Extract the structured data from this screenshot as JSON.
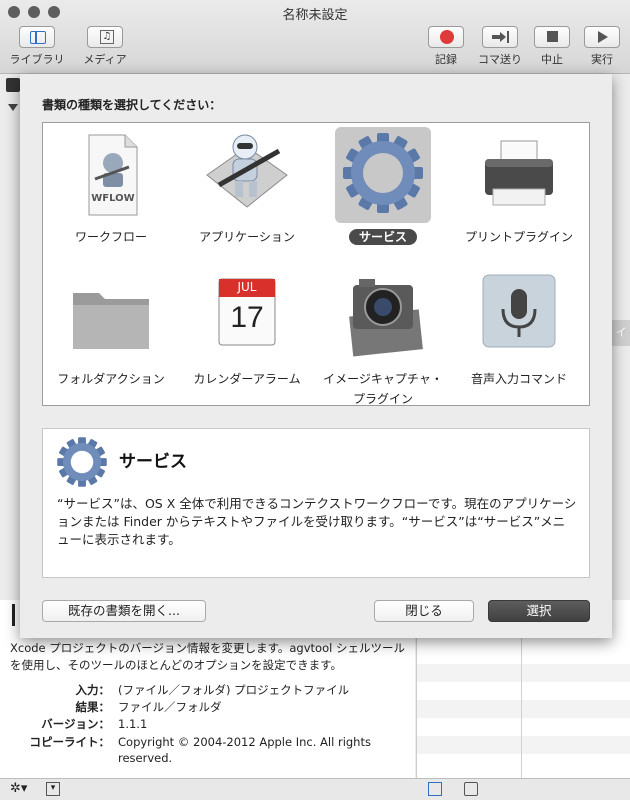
{
  "window": {
    "title": "名称未設定",
    "toolbar_left": [
      "ライブラリ",
      "メディア"
    ],
    "toolbar_right": [
      "記録",
      "コマ送り",
      "中止",
      "実行"
    ]
  },
  "sheet": {
    "heading": "書類の種類を選択してください：",
    "types": [
      {
        "label": "ワークフロー",
        "icon": "workflow-document-icon",
        "badge": "WFLOW"
      },
      {
        "label": "アプリケーション",
        "icon": "robot-icon"
      },
      {
        "label": "サービス",
        "icon": "gear-icon",
        "selected": true
      },
      {
        "label": "プリントプラグイン",
        "icon": "printer-icon"
      },
      {
        "label": "フォルダアクション",
        "icon": "folder-icon"
      },
      {
        "label": "カレンダーアラーム",
        "icon": "calendar-icon",
        "month": "JUL",
        "day": "17"
      },
      {
        "label": "イメージキャプチャ・プラグイン",
        "icon": "camera-icon"
      },
      {
        "label": "音声入力コマンド",
        "icon": "microphone-icon"
      }
    ],
    "detail": {
      "title": "サービス",
      "description": "“サービス”は、OS X 全体で利用できるコンテクストワークフローです。現在のアプリケーションまたは Finder からテキストやファイルを受け取ります。“サービス”は“サービス”メニューに表示されます。"
    },
    "buttons": {
      "open_existing": "既存の書類を開く...",
      "close": "閉じる",
      "choose": "選択"
    }
  },
  "background": {
    "description": "Xcode プロジェクトのバージョン情報を変更します。agvtool シェルツールを使用し、そのツールのほとんどのオプションを設定できます。",
    "info": [
      {
        "key": "入力：",
        "value": "(ファイル／フォルダ) プロジェクトファイル"
      },
      {
        "key": "結果：",
        "value": "ファイル／フォルダ"
      },
      {
        "key": "バージョン：",
        "value": "1.1.1"
      },
      {
        "key": "コピーライト：",
        "value": "Copyright © 2004-2012 Apple Inc.  All rights reserved."
      }
    ],
    "side_tab": "イ"
  },
  "colors": {
    "selected_label_bg": "#4a4a4a",
    "primary_button": "#4a4a4a",
    "record_red": "#e03a3a"
  }
}
